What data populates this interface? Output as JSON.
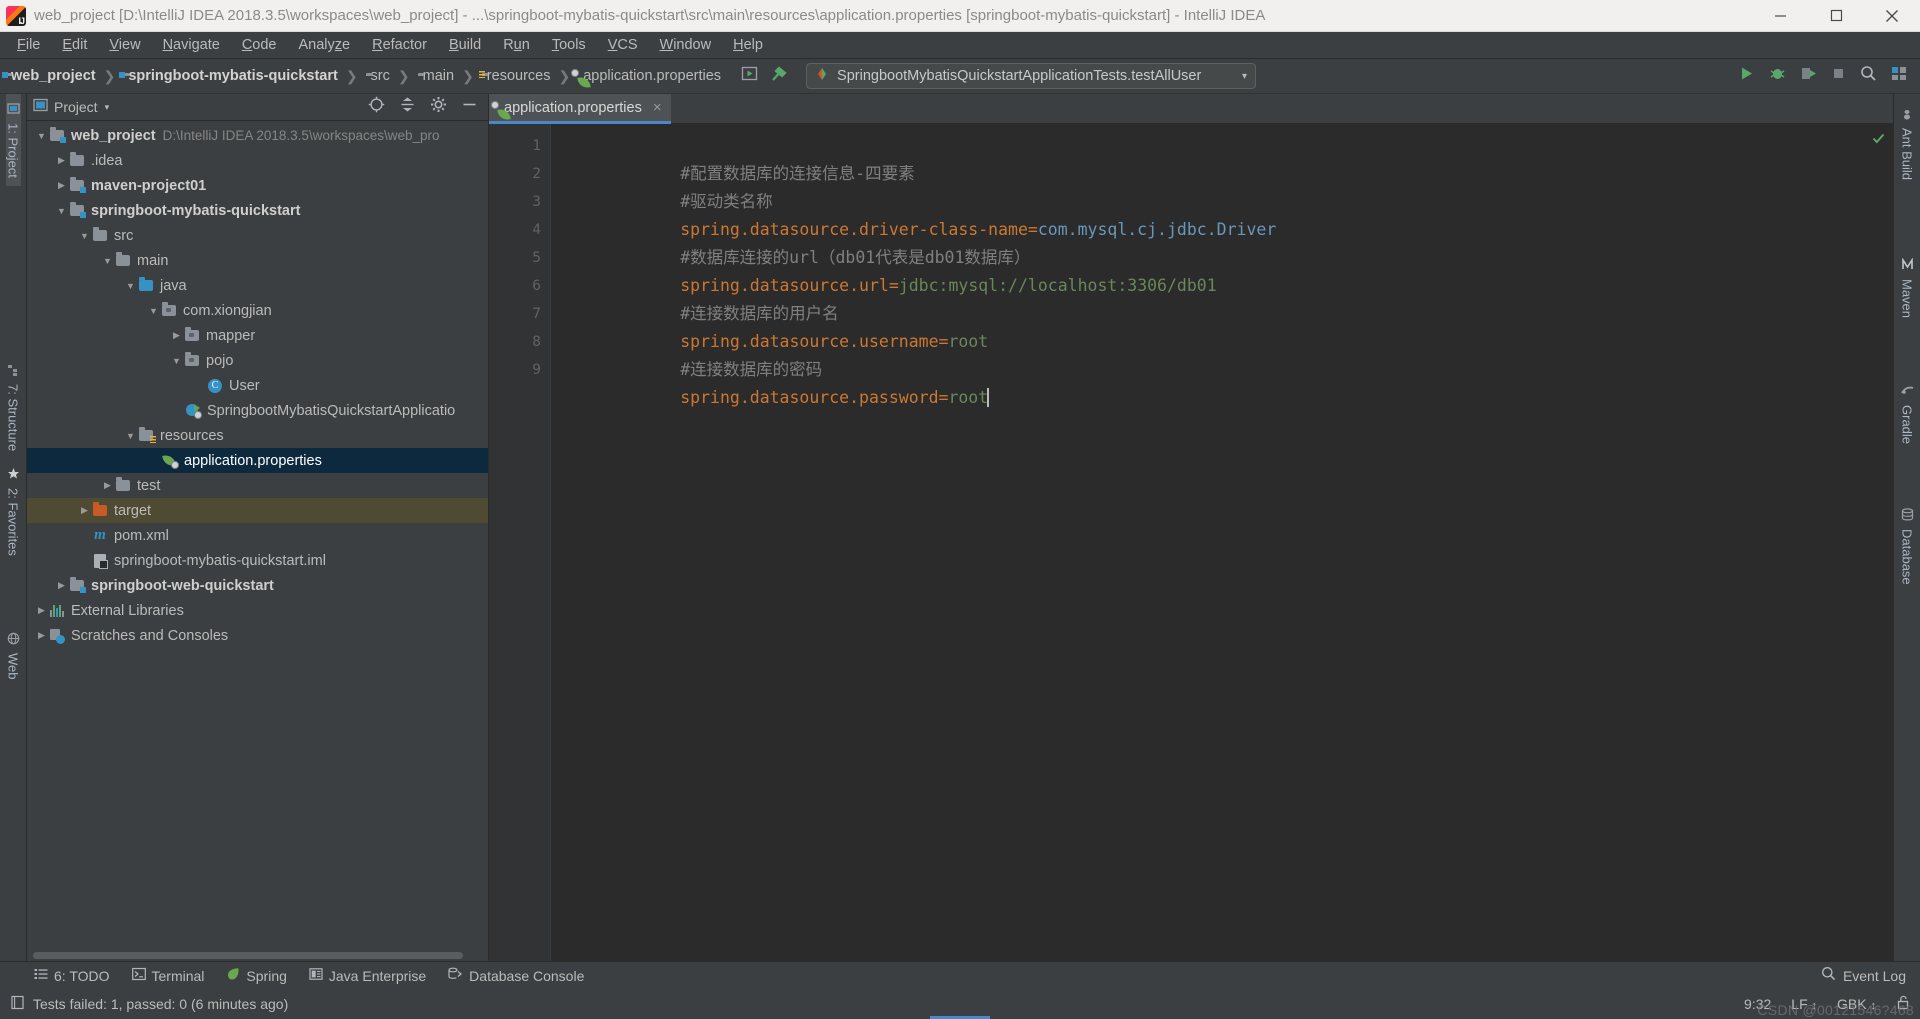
{
  "window": {
    "title": "web_project [D:\\IntelliJ IDEA 2018.3.5\\workspaces\\web_project] - ...\\springboot-mybatis-quickstart\\src\\main\\resources\\application.properties [springboot-mybatis-quickstart] - IntelliJ IDEA",
    "app_icon": "intellij-idea-logo",
    "minimize": "minimize-icon",
    "maximize": "maximize-icon",
    "close": "close-icon"
  },
  "menu": {
    "items": [
      {
        "label": "File",
        "mnemonic": "F"
      },
      {
        "label": "Edit",
        "mnemonic": "E"
      },
      {
        "label": "View",
        "mnemonic": "V"
      },
      {
        "label": "Navigate",
        "mnemonic": "N"
      },
      {
        "label": "Code",
        "mnemonic": "C"
      },
      {
        "label": "Analyze",
        "mnemonic": "z"
      },
      {
        "label": "Refactor",
        "mnemonic": "R"
      },
      {
        "label": "Build",
        "mnemonic": "B"
      },
      {
        "label": "Run",
        "mnemonic": "u"
      },
      {
        "label": "Tools",
        "mnemonic": "T"
      },
      {
        "label": "VCS",
        "mnemonic": "V"
      },
      {
        "label": "Window",
        "mnemonic": "W"
      },
      {
        "label": "Help",
        "mnemonic": "H"
      }
    ]
  },
  "breadcrumb": {
    "items": [
      {
        "label": "web_project",
        "icon": "module-folder-icon",
        "bold": true
      },
      {
        "label": "springboot-mybatis-quickstart",
        "icon": "module-folder-icon",
        "bold": true
      },
      {
        "label": "src",
        "icon": "folder-icon",
        "bold": false
      },
      {
        "label": "main",
        "icon": "folder-icon",
        "bold": false
      },
      {
        "label": "resources",
        "icon": "resources-folder-icon",
        "bold": false
      },
      {
        "label": "application.properties",
        "icon": "spring-properties-icon",
        "bold": false
      }
    ],
    "separator": "❯"
  },
  "toolbar": {
    "build_icons": [
      "make-project-icon",
      "build-hammer-icon"
    ],
    "run_configuration": "SpringbootMybatisQuickstartApplicationTests.testAllUser",
    "run_config_icon": "junit-test-icon",
    "run_config_caret": "▾",
    "right_icons": [
      "run-icon",
      "debug-icon",
      "run-coverage-icon",
      "stop-icon",
      "search-everywhere-icon",
      "settings-layout-icon"
    ]
  },
  "left_strip": {
    "tabs": [
      {
        "label": "1: Project",
        "icon": "project-tab-icon",
        "active": true
      },
      {
        "label": "7: Structure",
        "icon": "structure-tab-icon",
        "active": false
      },
      {
        "label": "2: Favorites",
        "icon": "favorites-star-icon",
        "active": false
      },
      {
        "label": "Web",
        "icon": "web-globe-icon",
        "active": false
      }
    ]
  },
  "right_strip": {
    "tabs": [
      {
        "label": "Ant Build",
        "icon": "ant-build-icon"
      },
      {
        "label": "Maven",
        "icon": "maven-icon"
      },
      {
        "label": "Gradle",
        "icon": "gradle-icon"
      },
      {
        "label": "Database",
        "icon": "database-icon"
      }
    ]
  },
  "project_pane": {
    "title": "Project",
    "caret": "▾",
    "view_icon": "project-view-icon",
    "header_tools": [
      "scroll-from-source-icon",
      "collapse-all-icon",
      "settings-gear-icon",
      "hide-icon"
    ],
    "tree": [
      {
        "label": "web_project",
        "hint": "D:\\IntelliJ IDEA 2018.3.5\\workspaces\\web_pro",
        "depth": 0,
        "arrow": "▼",
        "icon": "module-folder-icon",
        "bold": true,
        "state": "normal"
      },
      {
        "label": ".idea",
        "hint": "",
        "depth": 1,
        "arrow": "▶",
        "icon": "folder-icon",
        "bold": false,
        "state": "normal"
      },
      {
        "label": "maven-project01",
        "hint": "",
        "depth": 1,
        "arrow": "▶",
        "icon": "module-folder-icon",
        "bold": true,
        "state": "normal"
      },
      {
        "label": "springboot-mybatis-quickstart",
        "hint": "",
        "depth": 1,
        "arrow": "▼",
        "icon": "module-folder-icon",
        "bold": true,
        "state": "normal"
      },
      {
        "label": "src",
        "hint": "",
        "depth": 2,
        "arrow": "▼",
        "icon": "folder-icon",
        "bold": false,
        "state": "normal"
      },
      {
        "label": "main",
        "hint": "",
        "depth": 3,
        "arrow": "▼",
        "icon": "folder-icon",
        "bold": false,
        "state": "normal"
      },
      {
        "label": "java",
        "hint": "",
        "depth": 4,
        "arrow": "▼",
        "icon": "source-folder-icon",
        "bold": false,
        "state": "normal"
      },
      {
        "label": "com.xiongjian",
        "hint": "",
        "depth": 5,
        "arrow": "▼",
        "icon": "package-icon",
        "bold": false,
        "state": "normal"
      },
      {
        "label": "mapper",
        "hint": "",
        "depth": 6,
        "arrow": "▶",
        "icon": "package-icon",
        "bold": false,
        "state": "normal"
      },
      {
        "label": "pojo",
        "hint": "",
        "depth": 6,
        "arrow": "▼",
        "icon": "package-icon",
        "bold": false,
        "state": "normal"
      },
      {
        "label": "User",
        "hint": "",
        "depth": 7,
        "arrow": "",
        "icon": "java-class-icon",
        "bold": false,
        "state": "normal"
      },
      {
        "label": "SpringbootMybatisQuickstartApplicatio",
        "hint": "",
        "depth": 6,
        "arrow": "",
        "icon": "spring-boot-application-icon",
        "bold": false,
        "state": "normal"
      },
      {
        "label": "resources",
        "hint": "",
        "depth": 4,
        "arrow": "▼",
        "icon": "resources-folder-icon",
        "bold": false,
        "state": "normal"
      },
      {
        "label": "application.properties",
        "hint": "",
        "depth": 5,
        "arrow": "",
        "icon": "spring-properties-icon",
        "bold": false,
        "state": "selected"
      },
      {
        "label": "test",
        "hint": "",
        "depth": 3,
        "arrow": "▶",
        "icon": "folder-icon",
        "bold": false,
        "state": "normal"
      },
      {
        "label": "target",
        "hint": "",
        "depth": 2,
        "arrow": "▶",
        "icon": "excluded-folder-icon",
        "bold": false,
        "state": "highlighted"
      },
      {
        "label": "pom.xml",
        "hint": "",
        "depth": 2,
        "arrow": "",
        "icon": "maven-pom-icon",
        "bold": false,
        "state": "normal"
      },
      {
        "label": "springboot-mybatis-quickstart.iml",
        "hint": "",
        "depth": 2,
        "arrow": "",
        "icon": "iml-module-file-icon",
        "bold": false,
        "state": "normal"
      },
      {
        "label": "springboot-web-quickstart",
        "hint": "",
        "depth": 1,
        "arrow": "▶",
        "icon": "module-folder-icon",
        "bold": true,
        "state": "normal"
      },
      {
        "label": "External Libraries",
        "hint": "",
        "depth": 0,
        "arrow": "▶",
        "icon": "external-libraries-icon",
        "bold": false,
        "state": "normal"
      },
      {
        "label": "Scratches and Consoles",
        "hint": "",
        "depth": 0,
        "arrow": "▶",
        "icon": "scratches-icon",
        "bold": false,
        "state": "normal"
      }
    ]
  },
  "editor": {
    "tab": {
      "label": "application.properties",
      "icon": "spring-properties-icon",
      "close": "×"
    },
    "inspection_status": "ok-checkmark-icon",
    "lines": [
      {
        "num": "1",
        "type": "comment",
        "text": "#配置数据库的连接信息-四要素"
      },
      {
        "num": "2",
        "type": "comment",
        "text": "#驱动类名称"
      },
      {
        "num": "3",
        "type": "property",
        "key": "spring.datasource.driver-class-name",
        "eq": "=",
        "value": "com.mysql.cj.jdbc.Driver",
        "value_style": "blue"
      },
      {
        "num": "4",
        "type": "comment",
        "text": "#数据库连接的url（db01代表是db01数据库）"
      },
      {
        "num": "5",
        "type": "property",
        "key": "spring.datasource.url",
        "eq": "=",
        "value": "jdbc:mysql://localhost:3306/db01",
        "value_style": "green"
      },
      {
        "num": "6",
        "type": "comment",
        "text": "#连接数据库的用户名"
      },
      {
        "num": "7",
        "type": "property",
        "key": "spring.datasource.username",
        "eq": "=",
        "value": "root",
        "value_style": "green"
      },
      {
        "num": "8",
        "type": "comment",
        "text": "#连接数据库的密码"
      },
      {
        "num": "9",
        "type": "property",
        "key": "spring.datasource.password",
        "eq": "=",
        "value": "root",
        "value_style": "green",
        "caret_after": true
      }
    ]
  },
  "bottom_bar": {
    "items": [
      {
        "label": "6: TODO",
        "mnemonic": "6",
        "icon": "todo-list-icon"
      },
      {
        "label": "Terminal",
        "icon": "terminal-icon"
      },
      {
        "label": "Spring",
        "icon": "spring-leaf-icon"
      },
      {
        "label": "Java Enterprise",
        "icon": "java-enterprise-icon"
      },
      {
        "label": "Database Console",
        "icon": "database-console-icon"
      }
    ],
    "event_log": {
      "label": "Event Log",
      "icon": "event-log-icon"
    }
  },
  "status_bar": {
    "icon": "test-results-icon",
    "message": "Tests failed: 1, passed: 0 (6 minutes ago)",
    "caret_position": "9:32",
    "line_separator": "LF",
    "line_separator_caret": "↕",
    "encoding": "GBK",
    "encoding_caret": "↕",
    "lock_icon": "unlocked-icon",
    "watermark": "CSDN @00121546?468"
  },
  "colors": {
    "accent_blue": "#4a88c7",
    "selection_blue": "#0d293e",
    "target_highlight": "#4f4b32",
    "editor_bg": "#2b2b2b",
    "panel_bg": "#3c3f41",
    "gutter_bg": "#313335",
    "comment_gray": "#808080",
    "key_orange": "#cc7832",
    "value_blue": "#6897bb",
    "value_green": "#6a8759",
    "titlebar_bg": "#f1f0ee"
  }
}
